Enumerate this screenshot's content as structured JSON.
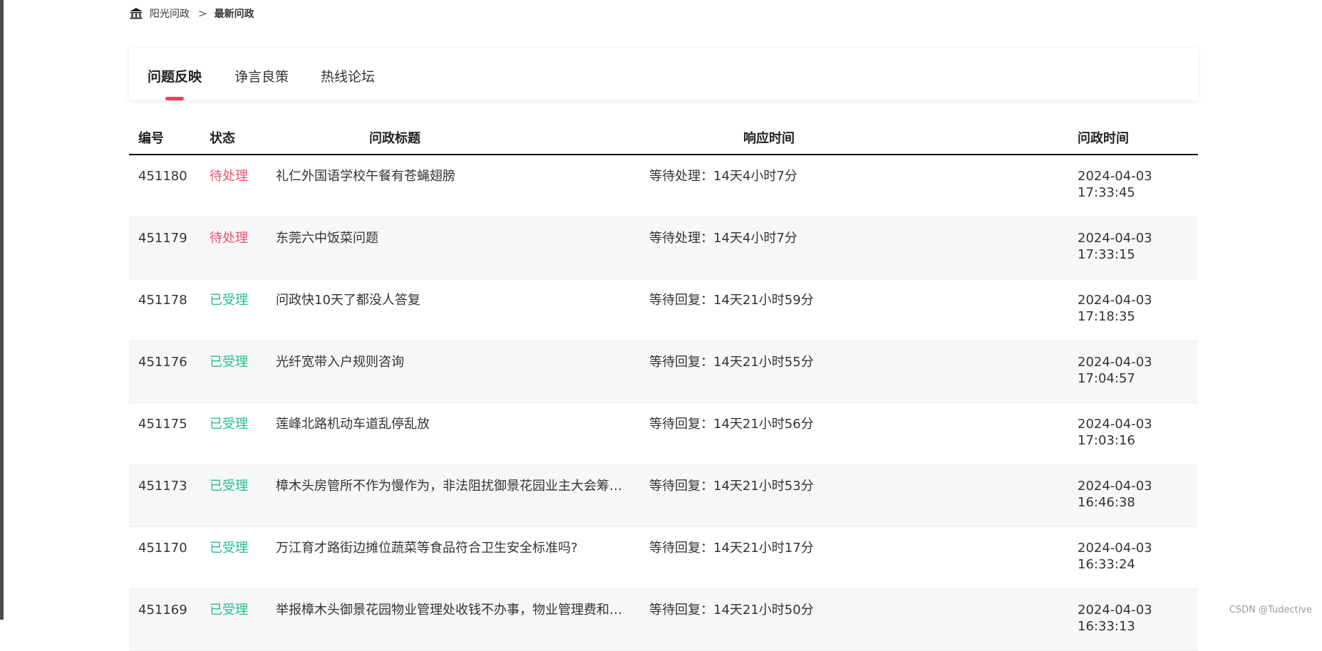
{
  "breadcrumb": {
    "icon": "bank-icon",
    "root": "阳光问政",
    "separator": ">",
    "current": "最新问政"
  },
  "tabs": [
    {
      "label": "问题反映",
      "active": true
    },
    {
      "label": "诤言良策",
      "active": false
    },
    {
      "label": "热线论坛",
      "active": false
    }
  ],
  "table": {
    "headers": {
      "id": "编号",
      "status": "状态",
      "title": "问政标题",
      "response": "响应时间",
      "time": "问政时间"
    },
    "rows": [
      {
        "id": "451180",
        "status": "待处理",
        "status_type": "pending",
        "title": "礼仁外国语学校午餐有苍蝇翅膀",
        "response": "等待处理：14天4小时7分",
        "date": "2024-04-03",
        "time": "17:33:45"
      },
      {
        "id": "451179",
        "status": "待处理",
        "status_type": "pending",
        "title": "东莞六中饭菜问题",
        "response": "等待处理：14天4小时7分",
        "date": "2024-04-03",
        "time": "17:33:15"
      },
      {
        "id": "451178",
        "status": "已受理",
        "status_type": "accepted",
        "title": "问政快10天了都没人答复",
        "response": "等待回复：14天21小时59分",
        "date": "2024-04-03",
        "time": "17:18:35"
      },
      {
        "id": "451176",
        "status": "已受理",
        "status_type": "accepted",
        "title": "光纤宽带入户规则咨询",
        "response": "等待回复：14天21小时55分",
        "date": "2024-04-03",
        "time": "17:04:57"
      },
      {
        "id": "451175",
        "status": "已受理",
        "status_type": "accepted",
        "title": "莲峰北路机动车道乱停乱放",
        "response": "等待回复：14天21小时56分",
        "date": "2024-04-03",
        "time": "17:03:16"
      },
      {
        "id": "451173",
        "status": "已受理",
        "status_type": "accepted",
        "title": "樟木头房管所不作为慢作为，非法阻扰御景花园业主大会筹备...",
        "response": "等待回复：14天21小时53分",
        "date": "2024-04-03",
        "time": "16:46:38"
      },
      {
        "id": "451170",
        "status": "已受理",
        "status_type": "accepted",
        "title": "万江育才路街边摊位蔬菜等食品符合卫生安全标准吗?",
        "response": "等待回复：14天21小时17分",
        "date": "2024-04-03",
        "time": "16:33:24"
      },
      {
        "id": "451169",
        "status": "已受理",
        "status_type": "accepted",
        "title": "举报樟木头御景花园物业管理处收钱不办事，物业管理费和公...",
        "response": "等待回复：14天21小时50分",
        "date": "2024-04-03",
        "time": "16:33:13"
      }
    ]
  },
  "colors": {
    "pending": "#f0506e",
    "accepted": "#1fbf94",
    "accent": "#f43f5e"
  },
  "watermark": "CSDN @Tudective"
}
